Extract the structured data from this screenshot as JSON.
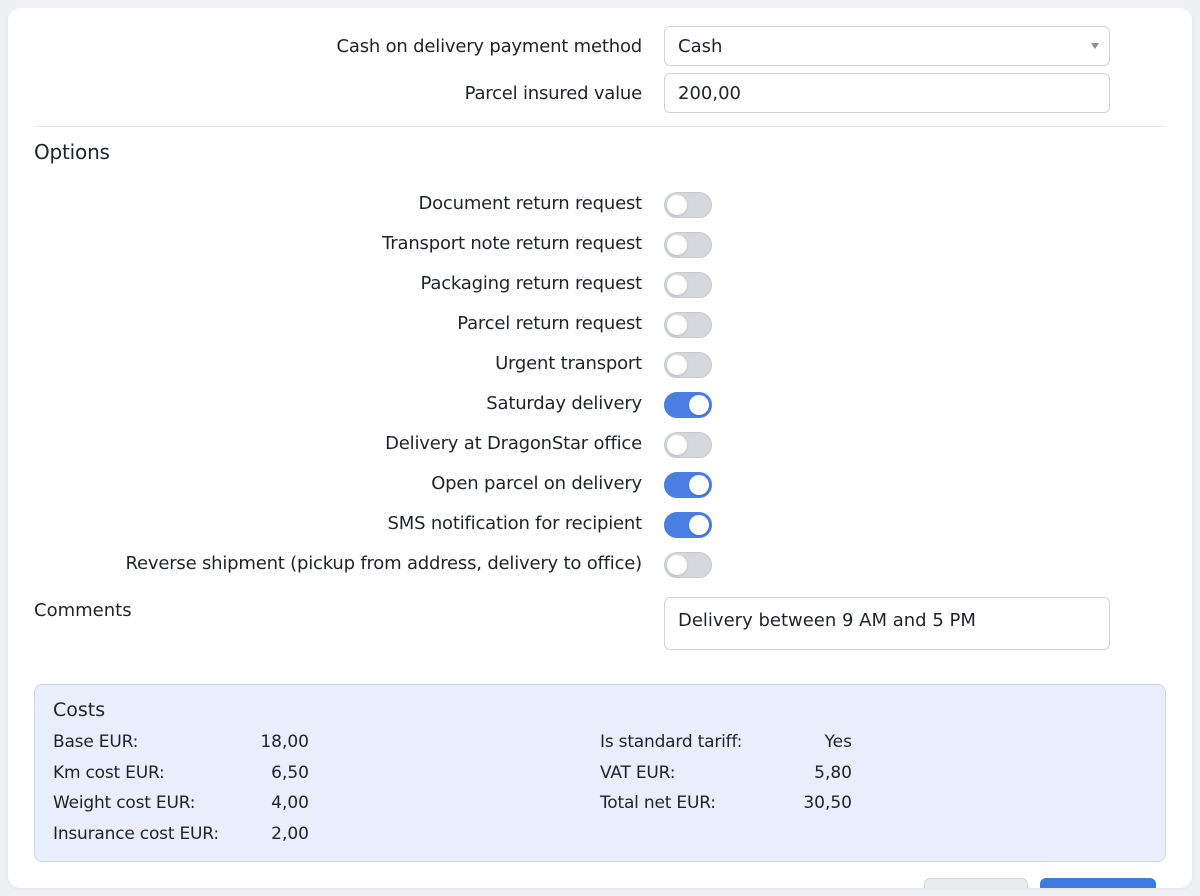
{
  "payment": {
    "cod_method_label": "Cash on delivery payment method",
    "cod_method_value": "Cash",
    "insured_label": "Parcel insured value",
    "insured_value": "200,00"
  },
  "options": {
    "title": "Options",
    "items": [
      {
        "label": "Document return request",
        "on": false
      },
      {
        "label": "Transport note return request",
        "on": false
      },
      {
        "label": "Packaging return request",
        "on": false
      },
      {
        "label": "Parcel return request",
        "on": false
      },
      {
        "label": "Urgent transport",
        "on": false
      },
      {
        "label": "Saturday delivery",
        "on": true
      },
      {
        "label": "Delivery at DragonStar office",
        "on": false
      },
      {
        "label": "Open parcel on delivery",
        "on": true
      },
      {
        "label": "SMS notification for recipient",
        "on": true
      },
      {
        "label": "Reverse shipment (pickup from address, delivery to office)",
        "on": false
      }
    ]
  },
  "comments": {
    "label": "Comments",
    "value": "Delivery between 9 AM and 5 PM"
  },
  "costs": {
    "title": "Costs",
    "left": [
      {
        "label": "Base EUR:",
        "value": "18,00"
      },
      {
        "label": "Km cost EUR:",
        "value": "6,50"
      },
      {
        "label": "Weight cost EUR:",
        "value": "4,00"
      },
      {
        "label": "Insurance cost EUR:",
        "value": "2,00"
      }
    ],
    "right": [
      {
        "label": "Is standard tariff:",
        "value": "Yes"
      },
      {
        "label": "VAT EUR:",
        "value": "5,80"
      },
      {
        "label": "Total net EUR:",
        "value": "30,50"
      }
    ]
  },
  "colors": {
    "toggle_on": "#4a7ee0",
    "toggle_off": "#d5d8dd",
    "costs_bg": "#e8eefb",
    "primary_button": "#3f7ae0"
  }
}
